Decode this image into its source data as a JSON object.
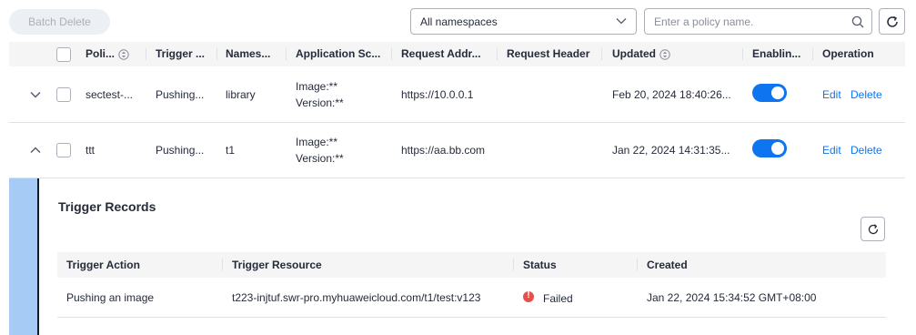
{
  "toolbar": {
    "batch_delete_label": "Batch Delete",
    "namespace_select_value": "All namespaces",
    "search_placeholder": "Enter a policy name."
  },
  "table": {
    "columns": [
      "Poli...",
      "Trigger ...",
      "Names...",
      "Application Sc...",
      "Request Addr...",
      "Request Header",
      "Updated",
      "Enablin...",
      "Operation"
    ],
    "rows": [
      {
        "policy": "sectest-...",
        "trigger": "Pushing...",
        "namespace": "library",
        "scope_image": "Image:**",
        "scope_version": "Version:**",
        "address": "https://10.0.0.1",
        "header": "",
        "updated": "Feb 20, 2024 18:40:26...",
        "enabled": true,
        "edit_label": "Edit",
        "delete_label": "Delete",
        "expanded": false
      },
      {
        "policy": "ttt",
        "trigger": "Pushing...",
        "namespace": "t1",
        "scope_image": "Image:**",
        "scope_version": "Version:**",
        "address": "https://aa.bb.com",
        "header": "",
        "updated": "Jan 22, 2024 14:31:35...",
        "enabled": true,
        "edit_label": "Edit",
        "delete_label": "Delete",
        "expanded": true
      }
    ]
  },
  "trigger_records": {
    "title": "Trigger Records",
    "columns": [
      "Trigger Action",
      "Trigger Resource",
      "Status",
      "Created"
    ],
    "rows": [
      {
        "action": "Pushing an image",
        "resource": "t223-injtuf.swr-pro.myhuaweicloud.com/t1/test:v123",
        "status": "Failed",
        "created": "Jan 22, 2024 15:34:52 GMT+08:00"
      }
    ]
  },
  "colors": {
    "accent": "#0e74ef",
    "failed": "#e7504a",
    "expand_bar": "#a6cbf4",
    "header_bg": "#f5f5f6"
  },
  "icons": {
    "expand_row_1": "chevron-down-icon",
    "expand_row_2": "chevron-up-icon",
    "search": "search-icon",
    "refresh": "refresh-icon",
    "sort": "sort-icon",
    "status_failed": "error-icon"
  }
}
